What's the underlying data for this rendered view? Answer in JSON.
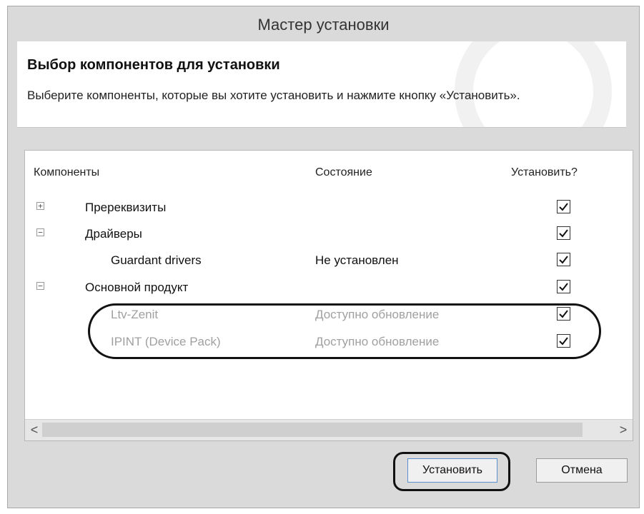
{
  "window": {
    "title": "Мастер установки"
  },
  "header": {
    "title": "Выбор компонентов для установки",
    "subtitle": "Выберите компоненты, которые вы хотите установить и нажмите кнопку «Установить»."
  },
  "table": {
    "columns": [
      "Компоненты",
      "Состояние",
      "Установить?"
    ],
    "rows": [
      {
        "name": "Пререквизиты",
        "state": "",
        "expander": "+",
        "checked": true,
        "greyed": false
      },
      {
        "name": "Драйверы",
        "state": "",
        "expander": "−",
        "checked": true,
        "greyed": false
      },
      {
        "name": "Guardant drivers",
        "state": "Не установлен",
        "expander": "",
        "checked": true,
        "greyed": false
      },
      {
        "name": "Основной продукт",
        "state": "",
        "expander": "−",
        "checked": true,
        "greyed": false
      },
      {
        "name": "Ltv-Zenit",
        "state": "Доступно обновление",
        "expander": "",
        "checked": true,
        "greyed": true
      },
      {
        "name": "IPINT (Device Pack)",
        "state": "Доступно обновление",
        "expander": "",
        "checked": true,
        "greyed": true
      }
    ]
  },
  "scrollbar": {
    "left_arrow": "<",
    "right_arrow": ">"
  },
  "buttons": {
    "install": "Установить",
    "cancel": "Отмена"
  }
}
